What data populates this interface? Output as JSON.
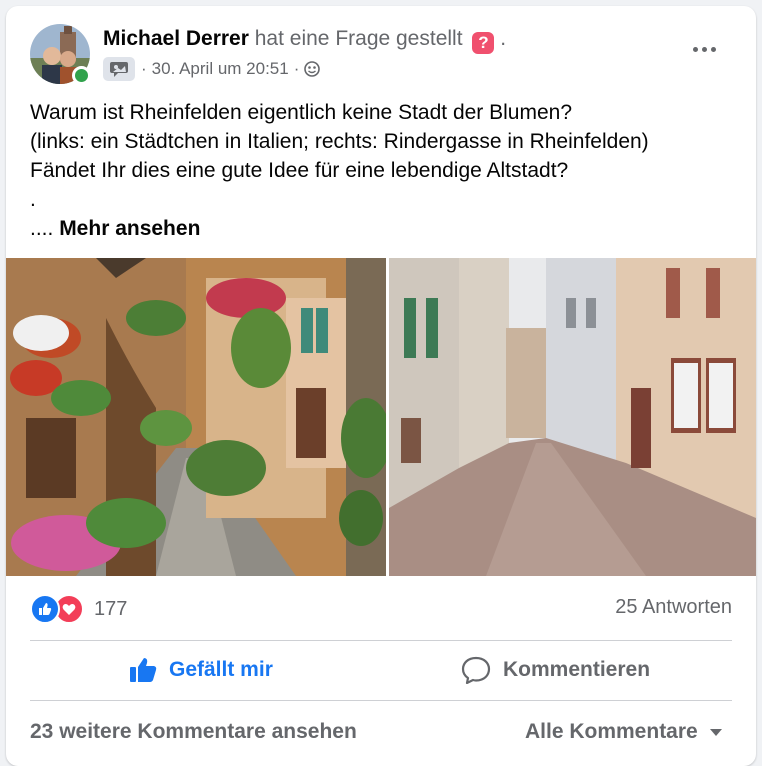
{
  "post": {
    "author": "Michael Derrer",
    "action": "hat eine Frage gestellt",
    "question_icon": "question-mark-icon",
    "trailing_dot": ".",
    "date": "30. April um 20:51",
    "separator": "·",
    "audience_icon": "globe-icon",
    "menu_icon": "more-options-icon",
    "lines": [
      "Warum ist Rheinfelden eigentlich keine Stadt der Blumen?",
      "(links: ein Städtchen in Italien; rechts: Rindergasse in Rheinfelden)",
      "Fändet Ihr dies eine gute Idee für eine lebendige Altstadt?",
      "."
    ],
    "see_more_prefix": "....",
    "see_more": "Mehr ansehen"
  },
  "reactions": {
    "icons": [
      "like-reaction-icon",
      "love-reaction-icon"
    ],
    "count": "177",
    "answers": "25 Antworten"
  },
  "actions": {
    "like": "Gefällt mir",
    "comment": "Kommentieren"
  },
  "footer": {
    "more_comments": "23 weitere Kommentare ansehen",
    "filter": "Alle Kommentare"
  },
  "colors": {
    "brand_blue": "#1877f2",
    "love_red": "#f33e58",
    "question_pink": "#f0506e",
    "online_green": "#31a24c",
    "secondary_text": "#65676b"
  }
}
